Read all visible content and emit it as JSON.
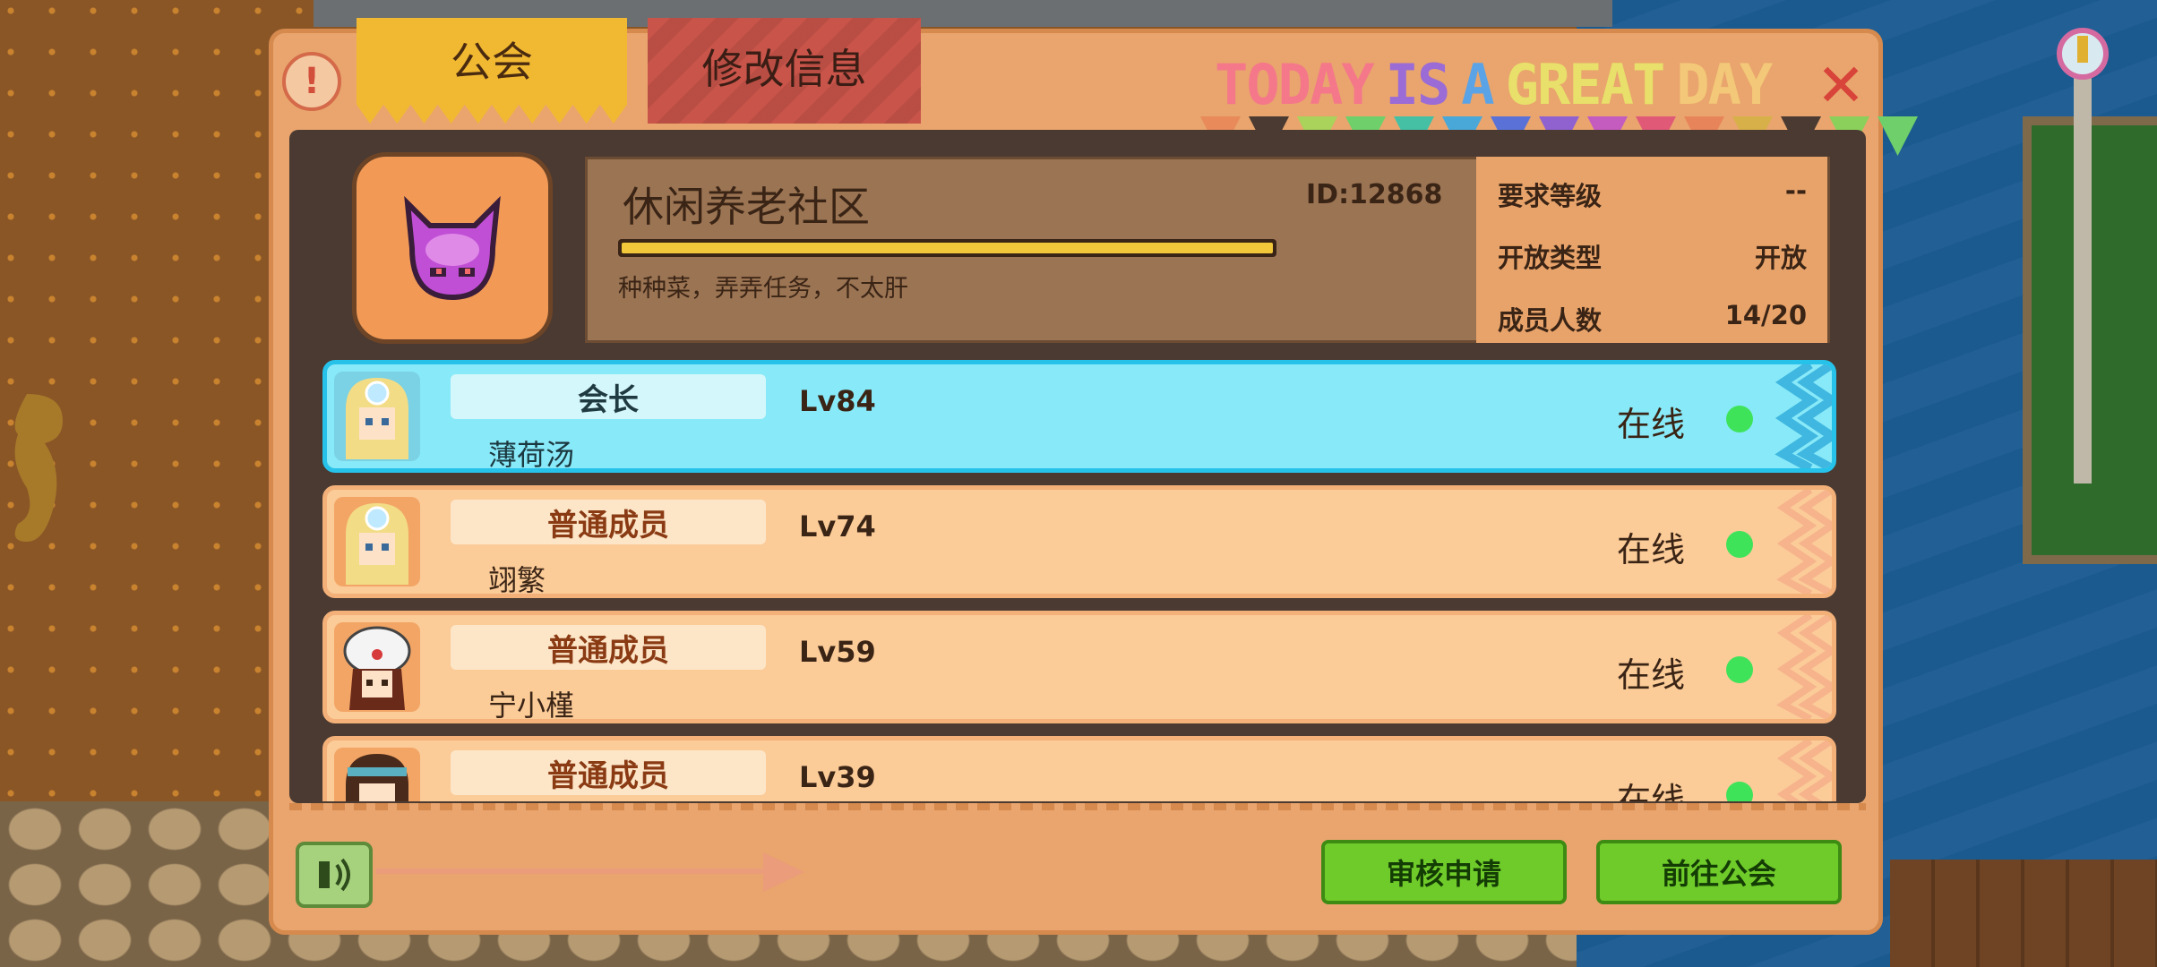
{
  "tabs": {
    "guild": "公会",
    "edit_info": "修改信息"
  },
  "banner": {
    "letters": [
      {
        "t": "T",
        "c": "#f4788a"
      },
      {
        "t": "O",
        "c": "#f4788a"
      },
      {
        "t": "D",
        "c": "#f4788a"
      },
      {
        "t": "A",
        "c": "#f4788a"
      },
      {
        "t": "Y",
        "c": "#f4788a"
      },
      {
        "t": " ",
        "c": "#000"
      },
      {
        "t": "I",
        "c": "#9b6bd6"
      },
      {
        "t": "S",
        "c": "#9b6bd6"
      },
      {
        "t": " ",
        "c": "#000"
      },
      {
        "t": "A",
        "c": "#5aa3e6"
      },
      {
        "t": " ",
        "c": "#000"
      },
      {
        "t": "G",
        "c": "#e8e06a"
      },
      {
        "t": "R",
        "c": "#e8e06a"
      },
      {
        "t": "E",
        "c": "#e8e06a"
      },
      {
        "t": "A",
        "c": "#e8e06a"
      },
      {
        "t": "T",
        "c": "#e8e06a"
      },
      {
        "t": " ",
        "c": "#000"
      },
      {
        "t": "D",
        "c": "#f3c878"
      },
      {
        "t": "A",
        "c": "#f3c878"
      },
      {
        "t": "Y",
        "c": "#f3c878"
      }
    ],
    "flag_colors": [
      "#e88a5a",
      "#4a3a32",
      "#a9d35a",
      "#6fcf6a",
      "#45c0a5",
      "#4aa8d8",
      "#5a72d8",
      "#9062d0",
      "#c45cc0",
      "#e05a78",
      "#e8845a",
      "#d8b04a",
      "#4a3a32",
      "#8ad05a",
      "#6fcf6a"
    ]
  },
  "guild": {
    "name": "休闲养老社区",
    "id": "ID:12868",
    "motto": "种种菜，弄弄任务，不太肝",
    "exp_fraction": 1.0,
    "stats": [
      {
        "label": "要求等级",
        "value": "--"
      },
      {
        "label": "开放类型",
        "value": "开放"
      },
      {
        "label": "成员人数",
        "value": "14/20"
      }
    ]
  },
  "members": [
    {
      "role": "会长",
      "name": "薄荷汤",
      "level": "Lv84",
      "status": "在线",
      "type": "leader"
    },
    {
      "role": "普通成员",
      "name": "翊繁",
      "level": "Lv74",
      "status": "在线",
      "type": "member"
    },
    {
      "role": "普通成员",
      "name": "宁小槿",
      "level": "Lv59",
      "status": "在线",
      "type": "member"
    },
    {
      "role": "普通成员",
      "name": "",
      "level": "Lv39",
      "status": "在线",
      "type": "member"
    }
  ],
  "footer": {
    "review_button": "审核申请",
    "goto_button": "前往公会"
  },
  "icons": {
    "help": "exclamation-circle-icon",
    "close": "close-x-icon",
    "voice": "speaker-icon"
  }
}
